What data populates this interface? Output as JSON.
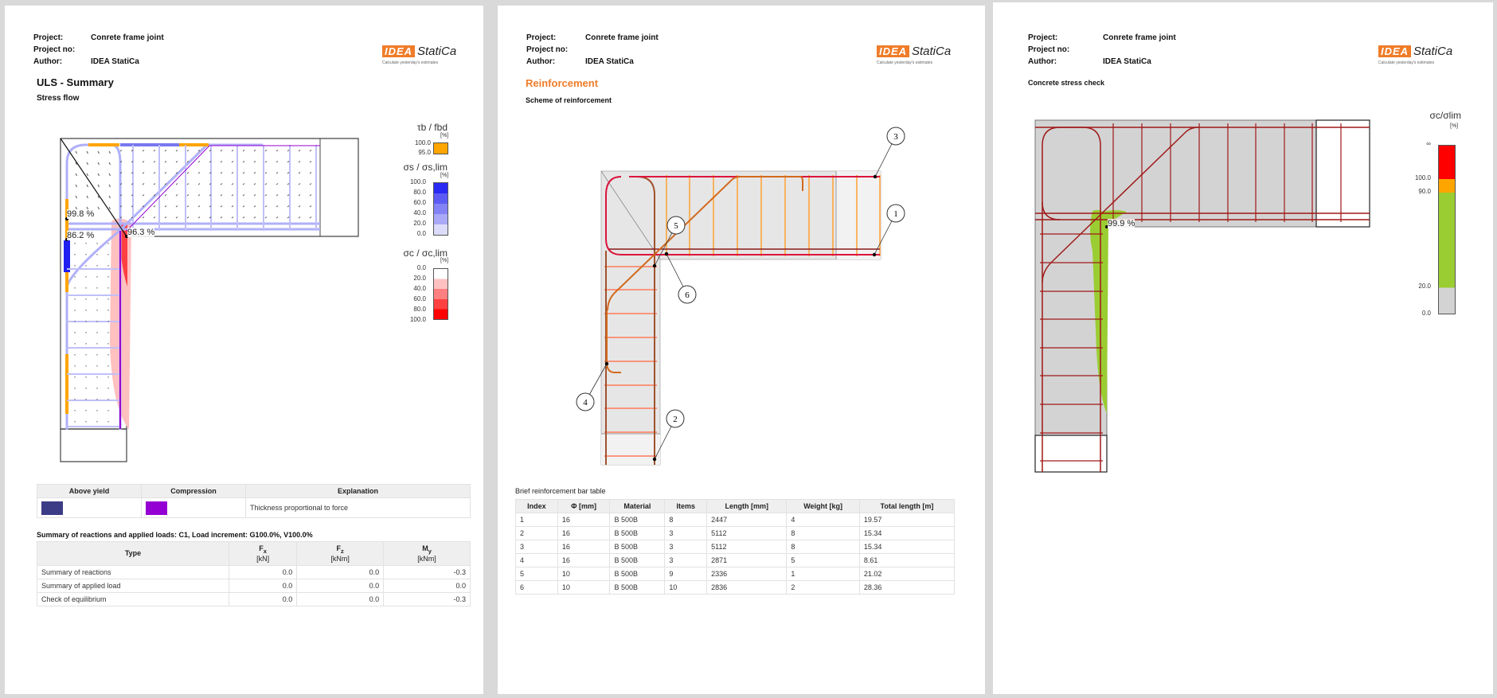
{
  "header": {
    "project_label": "Project:",
    "project_value": "Conrete frame joint",
    "project_no_label": "Project no:",
    "author_label": "Author:",
    "author_value": "IDEA StatiCa",
    "logo_box": "IDEA",
    "logo_name": "StatiCa",
    "logo_tagline": "Calculate yesterday's estimates"
  },
  "page1": {
    "title": "ULS - Summary",
    "subtitle": "Stress flow",
    "labels": [
      "99.8 %",
      "86.2 %",
      "96.3 %"
    ],
    "legend_bond": {
      "title": "τb / fbd",
      "unit": "[%]",
      "values": [
        "100.0",
        "95.0"
      ],
      "color": "#ffa500"
    },
    "legend_steel": {
      "title": "σs / σs,lim",
      "unit": "[%]",
      "values": [
        "100.0",
        "80.0",
        "60.0",
        "40.0",
        "20.0",
        "0.0"
      ]
    },
    "legend_concrete": {
      "title": "σc / σc,lim",
      "unit": "[%]",
      "values": [
        "0.0",
        "20.0",
        "40.0",
        "60.0",
        "80.0",
        "100.0"
      ]
    },
    "legend_table": {
      "headers": [
        "Above yield",
        "Compression",
        "Explanation"
      ],
      "above_yield_color": "#3b3b86",
      "compression_color": "#9400d3",
      "explanation": "Thickness proportional to force"
    },
    "summary_title": "Summary of reactions and applied loads: C1, Load increment: G100.0%, V100.0%",
    "summary_table": {
      "headers": [
        {
          "name": "Type"
        },
        {
          "name": "F",
          "sub": "x",
          "unit": "[kN]"
        },
        {
          "name": "F",
          "sub": "z",
          "unit": "[kNm]"
        },
        {
          "name": "M",
          "sub": "y",
          "unit": "[kNm]"
        }
      ],
      "rows": [
        [
          "Summary of reactions",
          "0.0",
          "0.0",
          "-0.3"
        ],
        [
          "Summary of applied load",
          "0.0",
          "0.0",
          "0.0"
        ],
        [
          "Check of equilibrium",
          "0.0",
          "0.0",
          "-0.3"
        ]
      ]
    }
  },
  "page2": {
    "title": "Reinforcement",
    "title_color": "#f07c28",
    "subtitle": "Scheme of reinforcement",
    "callouts": [
      "1",
      "2",
      "3",
      "4",
      "5",
      "6"
    ],
    "table_title": "Brief reinforcement bar table",
    "bar_table": {
      "headers": [
        "Index",
        "Φ [mm]",
        "Material",
        "Items",
        "Length [mm]",
        "Weight [kg]",
        "Total length [m]"
      ],
      "rows": [
        [
          "1",
          "16",
          "B 500B",
          "8",
          "2447",
          "4",
          "19.57"
        ],
        [
          "2",
          "16",
          "B 500B",
          "3",
          "5112",
          "8",
          "15.34"
        ],
        [
          "3",
          "16",
          "B 500B",
          "3",
          "5112",
          "8",
          "15.34"
        ],
        [
          "4",
          "16",
          "B 500B",
          "3",
          "2871",
          "5",
          "8.61"
        ],
        [
          "5",
          "10",
          "B 500B",
          "9",
          "2336",
          "1",
          "21.02"
        ],
        [
          "6",
          "10",
          "B 500B",
          "10",
          "2836",
          "2",
          "28.36"
        ]
      ]
    }
  },
  "page3": {
    "subtitle": "Concrete stress check",
    "label": "99.9 %",
    "legend": {
      "title": "σc/σlim",
      "unit": "[%]",
      "values": [
        "∞",
        "100.0",
        "90.0",
        "20.0",
        "0.0"
      ],
      "colors": [
        "#ff0000",
        "#ffa500",
        "#9acd32",
        "#d3d3d3"
      ]
    }
  }
}
